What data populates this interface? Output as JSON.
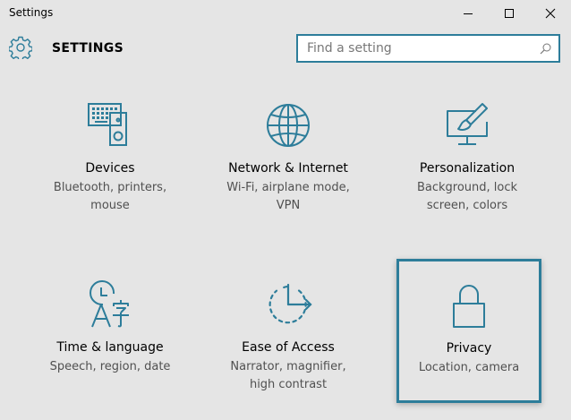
{
  "window": {
    "title": "Settings",
    "controls": [
      "minimize",
      "maximize",
      "close"
    ]
  },
  "header": {
    "title": "SETTINGS",
    "search_placeholder": "Find a setting"
  },
  "colors": {
    "accent": "#2d7d9a",
    "background": "#e5e5e5"
  },
  "tiles": [
    {
      "label": "Devices",
      "desc1": "Bluetooth, printers,",
      "desc2": "mouse",
      "icon": "devices-icon"
    },
    {
      "label": "Network & Internet",
      "desc1": "Wi-Fi, airplane mode,",
      "desc2": "VPN",
      "icon": "globe-icon"
    },
    {
      "label": "Personalization",
      "desc1": "Background, lock",
      "desc2": "screen, colors",
      "icon": "paintbrush-monitor-icon"
    },
    {
      "label": "Time & language",
      "desc1": "Speech, region, date",
      "desc2": "",
      "icon": "time-language-icon"
    },
    {
      "label": "Ease of Access",
      "desc1": "Narrator, magnifier,",
      "desc2": "high contrast",
      "icon": "ease-of-access-icon"
    },
    {
      "label": "Privacy",
      "desc1": "Location, camera",
      "desc2": "",
      "icon": "lock-icon",
      "selected": true
    }
  ]
}
